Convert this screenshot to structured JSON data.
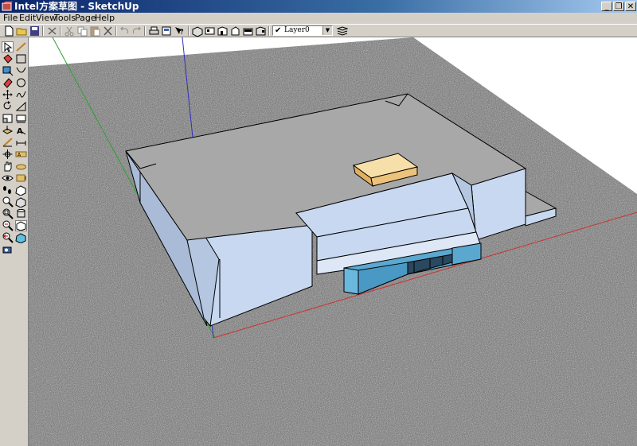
{
  "window": {
    "title": "Intel方案草图 - SketchUp",
    "controls": {
      "minimize": "_",
      "restore": "❐",
      "close": "✕"
    }
  },
  "menu": {
    "items": [
      "File",
      "Edit",
      "View",
      "Tools",
      "Page",
      "Help"
    ]
  },
  "toolbar": {
    "layer": {
      "check": "✔",
      "current": "Layer0",
      "dropdown_arrow": "▼"
    },
    "icons": [
      "new-icon",
      "open-icon",
      "save-icon",
      "cut-icon",
      "copy-icon",
      "paste-icon",
      "erase-icon",
      "undo-icon",
      "redo-icon",
      "print-icon",
      "model-info-icon",
      "context-help-icon",
      "iso-view-icon",
      "top-view-icon",
      "front-view-icon",
      "right-view-icon",
      "back-view-icon",
      "left-view-icon",
      "layers-icon"
    ]
  },
  "tools": {
    "icons": [
      "select-icon",
      "line-icon",
      "paint-bucket-icon",
      "rectangle-icon",
      "tape-measure-icon",
      "arc-icon",
      "eraser-icon",
      "circle-icon",
      "move-icon",
      "freehand-icon",
      "rotate-icon",
      "polygon-icon",
      "scale-icon",
      "section-plane-icon",
      "pushpull-icon",
      "text-icon",
      "protractor-icon",
      "dimension-icon",
      "orbit-icon",
      "axes-icon",
      "pan-icon",
      "3d-text-icon",
      "walk-icon",
      "look-around-icon",
      "zoom-icon",
      "zoom-window-icon",
      "zoom-extents-icon",
      "previous-view-icon",
      "position-camera-icon"
    ]
  },
  "colors": {
    "ground": "#6e6e6e",
    "roof": "#a8a8a8",
    "wall_light": "#c8d8f0",
    "wall_shade": "#a9bbd6",
    "glass": "#5aa8d0",
    "box_top": "#f6dfa8",
    "box_side": "#e0b060",
    "axis_red": "#d03030",
    "axis_green": "#30a030",
    "axis_blue": "#3030c0"
  }
}
